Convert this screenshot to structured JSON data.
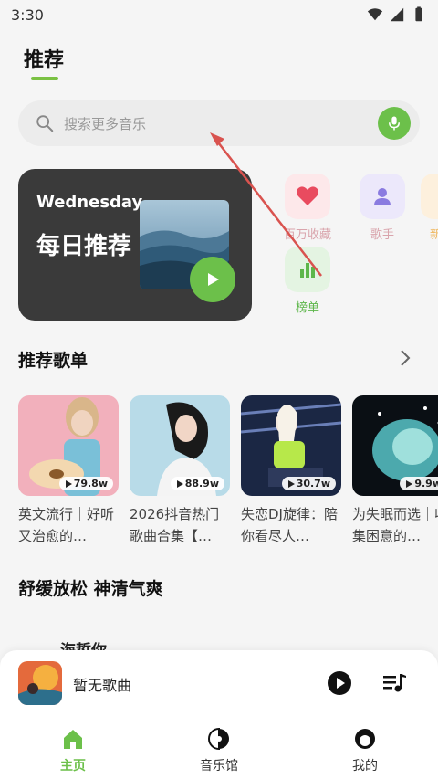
{
  "status_bar": {
    "time": "3:30"
  },
  "header": {
    "title": "推荐"
  },
  "search": {
    "placeholder": "搜索更多音乐"
  },
  "daily": {
    "weekday": "Wednesday",
    "title": "每日推荐"
  },
  "shortcuts": [
    {
      "label": "百万收藏",
      "icon": "heart-icon"
    },
    {
      "label": "歌手",
      "icon": "person-icon"
    },
    {
      "label": "新",
      "icon": "new-icon"
    },
    {
      "label": "榜单",
      "icon": "chart-icon"
    }
  ],
  "sections": {
    "playlists_title": "推荐歌单",
    "relax_title": "舒缓放松  神清气爽"
  },
  "playlists": [
    {
      "plays": "79.8w",
      "title": "英文流行｜好听又治愈的…"
    },
    {
      "plays": "88.9w",
      "title": "2026抖音热门歌曲合集【…"
    },
    {
      "plays": "30.7w",
      "title": "失恋DJ旋律：陪你看尽人…"
    },
    {
      "plays": "9.9w",
      "title": "为失眠而选｜收集困意的…"
    }
  ],
  "peek_text": "海蜇你",
  "player": {
    "song": "暂无歌曲"
  },
  "tabs": [
    {
      "label": "主页",
      "icon": "home-icon",
      "active": true
    },
    {
      "label": "音乐馆",
      "icon": "music-hall-icon",
      "active": false
    },
    {
      "label": "我的",
      "icon": "profile-icon",
      "active": false
    }
  ],
  "colors": {
    "accent": "#6cc04a",
    "background": "#f5f5f5",
    "card_dark": "#3a3a3a",
    "annotation_arrow": "#d9534f"
  }
}
